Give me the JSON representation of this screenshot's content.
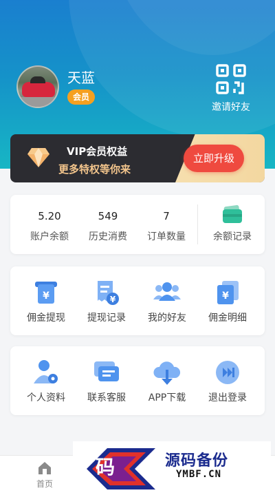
{
  "user": {
    "name": "天蓝",
    "badge": "会员"
  },
  "invite": {
    "label": "邀请好友",
    "icon": "qrcode-icon"
  },
  "vip": {
    "title": "VIP会员权益",
    "subtitle": "更多特权等你来",
    "button": "立即升级",
    "icon": "diamond-icon"
  },
  "stats": [
    {
      "value": "5.20",
      "label": "账户余额"
    },
    {
      "value": "549",
      "label": "历史消费"
    },
    {
      "value": "7",
      "label": "订单数量"
    }
  ],
  "balance_record": {
    "label": "余额记录",
    "icon": "wallet-icon"
  },
  "menu_row1": [
    {
      "label": "佣金提现",
      "icon": "withdraw-icon"
    },
    {
      "label": "提现记录",
      "icon": "record-icon"
    },
    {
      "label": "我的好友",
      "icon": "friends-icon"
    },
    {
      "label": "佣金明细",
      "icon": "commission-icon"
    }
  ],
  "menu_row2": [
    {
      "label": "个人资料",
      "icon": "profile-icon"
    },
    {
      "label": "联系客服",
      "icon": "service-icon"
    },
    {
      "label": "APP下载",
      "icon": "download-icon"
    },
    {
      "label": "退出登录",
      "icon": "logout-icon"
    }
  ],
  "tabbar": {
    "home_label": "首页",
    "icon": "home-icon"
  },
  "watermark": {
    "glyph": "码",
    "title": "源码备份",
    "url": "YMBF.CN"
  },
  "colors": {
    "header_top": "#1a7fcf",
    "header_bottom": "#17b6c4",
    "accent_blue": "#4a90f0",
    "upgrade_red": "#ef4a3f",
    "badge_orange": "#f5a020"
  }
}
